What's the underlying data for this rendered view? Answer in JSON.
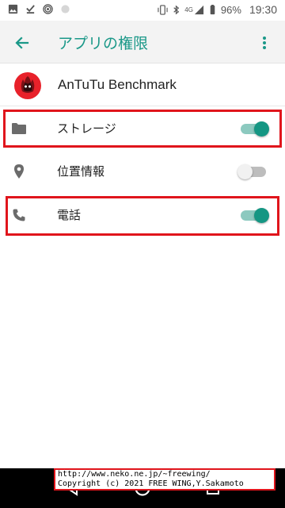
{
  "status_bar": {
    "battery": "96%",
    "time": "19:30",
    "network": "4G"
  },
  "app_bar": {
    "title": "アプリの権限"
  },
  "app": {
    "name": "AnTuTu Benchmark"
  },
  "permissions": [
    {
      "label": "ストレージ",
      "icon": "folder-icon",
      "enabled": true
    },
    {
      "label": "位置情報",
      "icon": "location-icon",
      "enabled": false
    },
    {
      "label": "電話",
      "icon": "phone-icon",
      "enabled": true
    }
  ],
  "watermark": {
    "line1": "http://www.neko.ne.jp/~freewing/",
    "line2": "Copyright (c) 2021 FREE WING,Y.Sakamoto"
  },
  "colors": {
    "accent": "#1a9888",
    "toggle_on": "#149683",
    "highlight": "#e0151c"
  }
}
